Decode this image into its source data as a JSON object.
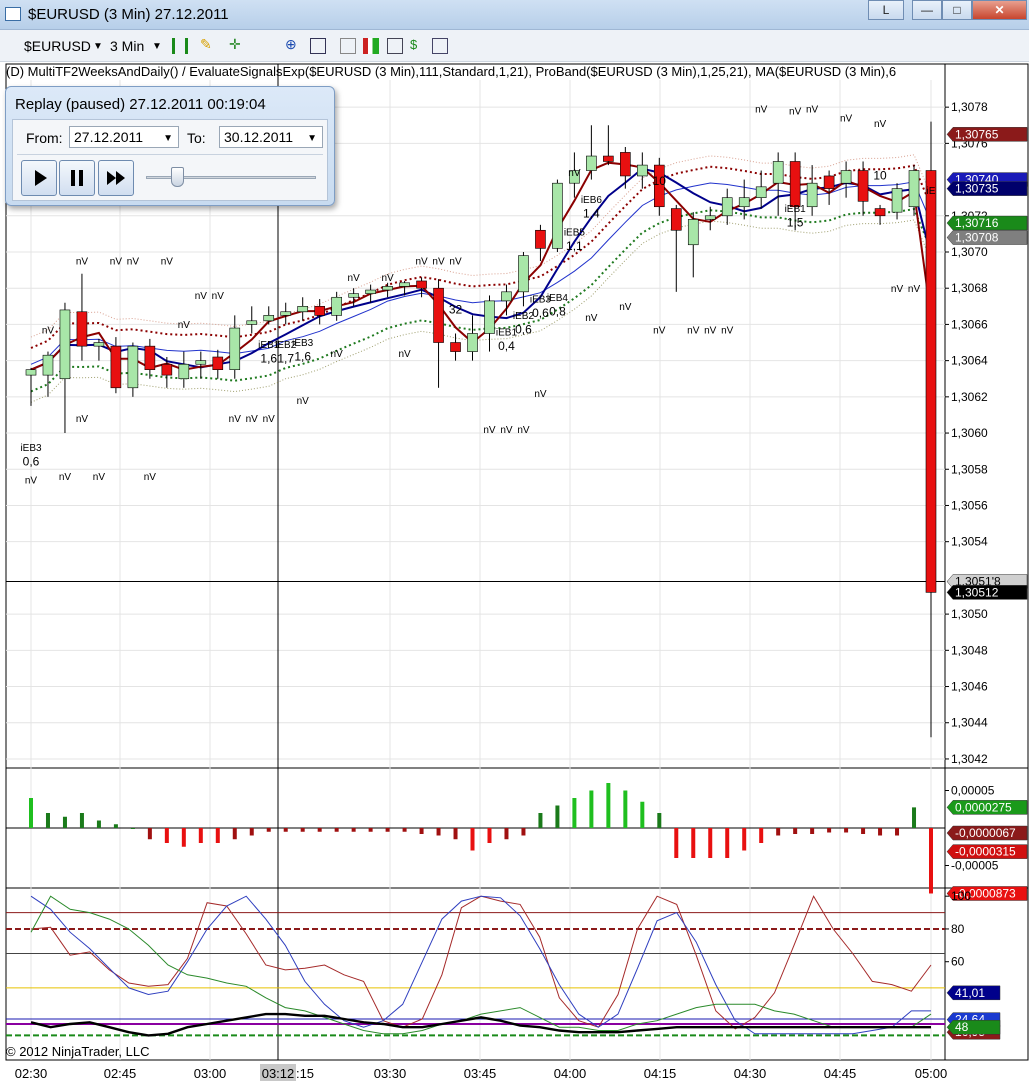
{
  "window": {
    "title": "$EURUSD (3 Min)  27.12.2011",
    "buttons": [
      "L",
      "—",
      "□",
      "✕"
    ]
  },
  "toolbar": {
    "instrument": "$EURUSD",
    "interval": "3 Min",
    "icons": [
      "bar-style-icon",
      "pencil-icon",
      "crosshair-icon",
      "zoom-icon",
      "data-box-icon",
      "properties-icon",
      "bar-chart-icon",
      "line-chart-icon",
      "dollar-icon",
      "order-icon"
    ]
  },
  "indicator_line": "(D)  MultiTF2WeeksAndDaily()  /  EvaluateSignalsExp($EURUSD  (3  Min),111,Standard,1,21),  ProBand($EURUSD  (3  Min),1,25,21),  MA($EURUSD  (3  Min),6",
  "replay": {
    "title": "Replay (paused) 27.12.2011 00:19:04",
    "from_label": "From:",
    "from_value": "27.12.2011",
    "to_label": "To:",
    "to_value": "30.12.2011",
    "slider_position": 0.18
  },
  "copyright": "© 2012 NinjaTrader, LLC",
  "colors": {
    "up_candle": "#a8e6a8",
    "down_candle": "#e81010",
    "ma_fast": "#8b0000",
    "ma_slow": "#00008b",
    "band_upper": "#8b0000",
    "band_lower": "#1f7a1f",
    "osc_up": "#1fbf1f",
    "osc_down": "#e81010"
  },
  "chart_data": {
    "type": "candlestick",
    "x_ticks": [
      "02:30",
      "02:45",
      "03:00",
      "03:12",
      "03:30",
      "03:45",
      "04:00",
      "04:15",
      "04:30",
      "04:45",
      "05:00"
    ],
    "x_tick_extra": ":15",
    "cursor_time": "03:12",
    "price_ticks": [
      "1,3078",
      "1,3076",
      "1,3072",
      "1,3070",
      "1,3068",
      "1,3066",
      "1,3064",
      "1,3062",
      "1,3060",
      "1,3058",
      "1,3056",
      "1,3054",
      "1,3050",
      "1,3048",
      "1,3046",
      "1,3044",
      "1,3042"
    ],
    "price_labels": [
      {
        "text": "1,30765",
        "value": 1.30765,
        "color": "#8b1a1a"
      },
      {
        "text": "1,30740",
        "value": 1.3074,
        "color": "#1a1ab8"
      },
      {
        "text": "1,30735",
        "value": 1.30735,
        "color": "#00006b"
      },
      {
        "text": "1,30716",
        "value": 1.30716,
        "color": "#1a8a1a"
      },
      {
        "text": "1,30708",
        "value": 1.30708,
        "color": "#7f7f7f"
      },
      {
        "text": "1,3051'8",
        "value": 1.30518,
        "color": "#d0d0d0"
      },
      {
        "text": "1,30512",
        "value": 1.30512,
        "color": "#000000"
      }
    ],
    "price_range": [
      1.30415,
      1.30795
    ],
    "candles": [
      [
        1.30632,
        1.30635,
        1.30615,
        1.30636
      ],
      [
        1.30632,
        1.30643,
        1.3062,
        1.30645
      ],
      [
        1.3063,
        1.30668,
        1.306,
        1.30672
      ],
      [
        1.30667,
        1.30648,
        1.3064,
        1.30688
      ],
      [
        1.30648,
        1.3065,
        1.3064,
        1.30652
      ],
      [
        1.30648,
        1.30625,
        1.30622,
        1.30653
      ],
      [
        1.30625,
        1.30648,
        1.3062,
        1.3065
      ],
      [
        1.30648,
        1.30635,
        1.3063,
        1.30652
      ],
      [
        1.30638,
        1.30632,
        1.30625,
        1.30642
      ],
      [
        1.3063,
        1.30638,
        1.30625,
        1.30645
      ],
      [
        1.30638,
        1.3064,
        1.3063,
        1.30645
      ],
      [
        1.30642,
        1.30635,
        1.3063,
        1.30646
      ],
      [
        1.30635,
        1.30658,
        1.3063,
        1.30665
      ],
      [
        1.3066,
        1.30662,
        1.30655,
        1.3067
      ],
      [
        1.30662,
        1.30665,
        1.3066,
        1.3067
      ],
      [
        1.30665,
        1.30667,
        1.3066,
        1.30672
      ],
      [
        1.30667,
        1.3067,
        1.30662,
        1.30675
      ],
      [
        1.3067,
        1.30665,
        1.3066,
        1.30674
      ],
      [
        1.30665,
        1.30675,
        1.30662,
        1.30678
      ],
      [
        1.30675,
        1.30677,
        1.3067,
        1.3068
      ],
      [
        1.30677,
        1.30679,
        1.30672,
        1.30682
      ],
      [
        1.30679,
        1.30681,
        1.30675,
        1.30683
      ],
      [
        1.30681,
        1.30683,
        1.30676,
        1.30684
      ],
      [
        1.30684,
        1.3068,
        1.30675,
        1.30686
      ],
      [
        1.3068,
        1.3065,
        1.30625,
        1.30685
      ],
      [
        1.3065,
        1.30645,
        1.3064,
        1.30655
      ],
      [
        1.30645,
        1.30655,
        1.3064,
        1.30665
      ],
      [
        1.30655,
        1.30673,
        1.30645,
        1.30676
      ],
      [
        1.30673,
        1.30678,
        1.30665,
        1.30682
      ],
      [
        1.30678,
        1.30698,
        1.3067,
        1.307
      ],
      [
        1.30712,
        1.30702,
        1.30695,
        1.30715
      ],
      [
        1.30702,
        1.30738,
        1.307,
        1.3074
      ],
      [
        1.30738,
        1.30745,
        1.3073,
        1.30755
      ],
      [
        1.30745,
        1.30753,
        1.3074,
        1.3077
      ],
      [
        1.30753,
        1.3075,
        1.30748,
        1.3077
      ],
      [
        1.30755,
        1.30742,
        1.30735,
        1.30758
      ],
      [
        1.30742,
        1.30748,
        1.30735,
        1.30755
      ],
      [
        1.30748,
        1.30725,
        1.3072,
        1.30752
      ],
      [
        1.30724,
        1.30712,
        1.30678,
        1.30726
      ],
      [
        1.30704,
        1.30718,
        1.30686,
        1.30722
      ],
      [
        1.30718,
        1.3072,
        1.30712,
        1.30725
      ],
      [
        1.3072,
        1.3073,
        1.30715,
        1.30735
      ],
      [
        1.30725,
        1.3073,
        1.30718,
        1.3074
      ],
      [
        1.3073,
        1.30736,
        1.30724,
        1.30745
      ],
      [
        1.30738,
        1.3075,
        1.3072,
        1.30755
      ],
      [
        1.3075,
        1.30725,
        1.30712,
        1.30755
      ],
      [
        1.30725,
        1.30738,
        1.3072,
        1.30748
      ],
      [
        1.30742,
        1.30735,
        1.30726,
        1.30745
      ],
      [
        1.30738,
        1.30745,
        1.3073,
        1.3075
      ],
      [
        1.30745,
        1.30728,
        1.3072,
        1.3075
      ],
      [
        1.30724,
        1.3072,
        1.30715,
        1.30726
      ],
      [
        1.30722,
        1.30735,
        1.30718,
        1.30738
      ],
      [
        1.30725,
        1.30745,
        1.3072,
        1.30748
      ],
      [
        1.30745,
        1.30512,
        1.30432,
        1.30772
      ]
    ],
    "signal_labels": [
      {
        "text": "iEB3",
        "bar": 0,
        "price": 1.3059
      },
      {
        "text": "0,6",
        "bar": 0,
        "price": 1.30582
      },
      {
        "text": "iEB1",
        "bar": 14,
        "price": 1.30647
      },
      {
        "text": "1,6",
        "bar": 14,
        "price": 1.30639
      },
      {
        "text": "iEB2",
        "bar": 15,
        "price": 1.30647
      },
      {
        "text": "1,7",
        "bar": 15,
        "price": 1.30639
      },
      {
        "text": "iEB3",
        "bar": 16,
        "price": 1.30648
      },
      {
        "text": "1,6",
        "bar": 16,
        "price": 1.3064
      },
      {
        "text": "32",
        "bar": 25,
        "price": 1.30666
      },
      {
        "text": "iEB1",
        "bar": 28,
        "price": 1.30654
      },
      {
        "text": "0,4",
        "bar": 28,
        "price": 1.30646
      },
      {
        "text": "iEB2",
        "bar": 29,
        "price": 1.30663
      },
      {
        "text": "0,6",
        "bar": 29,
        "price": 1.30655
      },
      {
        "text": "iEB3",
        "bar": 30,
        "price": 1.30672
      },
      {
        "text": "0,6",
        "bar": 30,
        "price": 1.30664
      },
      {
        "text": "iEB4",
        "bar": 31,
        "price": 1.30673
      },
      {
        "text": "0,8",
        "bar": 31,
        "price": 1.30665
      },
      {
        "text": "iEB5",
        "bar": 32,
        "price": 1.30709
      },
      {
        "text": "1,1",
        "bar": 32,
        "price": 1.30701
      },
      {
        "text": "iEB6",
        "bar": 33,
        "price": 1.30727
      },
      {
        "text": "1,4",
        "bar": 33,
        "price": 1.30719
      },
      {
        "text": "10",
        "bar": 37,
        "price": 1.30737
      },
      {
        "text": "iEB1",
        "bar": 45,
        "price": 1.30722
      },
      {
        "text": "1,5",
        "bar": 45,
        "price": 1.30714
      },
      {
        "text": "10",
        "bar": 50,
        "price": 1.3074
      },
      {
        "text": "iE",
        "bar": 53,
        "price": 1.30732
      }
    ],
    "nv_label": "nV",
    "nv_markers": [
      [
        0,
        1.30572
      ],
      [
        1,
        1.30655
      ],
      [
        2,
        1.30574
      ],
      [
        3,
        1.30606
      ],
      [
        3,
        1.30693
      ],
      [
        4,
        1.30574
      ],
      [
        5,
        1.30693
      ],
      [
        6,
        1.30693
      ],
      [
        7,
        1.30574
      ],
      [
        8,
        1.30693
      ],
      [
        9,
        1.30658
      ],
      [
        10,
        1.30674
      ],
      [
        11,
        1.30674
      ],
      [
        12,
        1.30606
      ],
      [
        13,
        1.30606
      ],
      [
        14,
        1.30606
      ],
      [
        16,
        1.30616
      ],
      [
        18,
        1.30642
      ],
      [
        19,
        1.30684
      ],
      [
        21,
        1.30684
      ],
      [
        22,
        1.30642
      ],
      [
        23,
        1.30693
      ],
      [
        24,
        1.30693
      ],
      [
        25,
        1.30693
      ],
      [
        27,
        1.306
      ],
      [
        28,
        1.306
      ],
      [
        29,
        1.306
      ],
      [
        30,
        1.3062
      ],
      [
        32,
        1.30742
      ],
      [
        33,
        1.30662
      ],
      [
        35,
        1.30668
      ],
      [
        37,
        1.30655
      ],
      [
        39,
        1.30655
      ],
      [
        40,
        1.30655
      ],
      [
        41,
        1.30655
      ],
      [
        43,
        1.30777
      ],
      [
        45,
        1.30776
      ],
      [
        46,
        1.30777
      ],
      [
        48,
        1.30772
      ],
      [
        50,
        1.30769
      ],
      [
        51,
        1.30678
      ],
      [
        52,
        1.30678
      ]
    ],
    "mid_osc": {
      "ticks": [
        "0,00005",
        "-0,00005"
      ],
      "range": [
        -8e-05,
        8e-05
      ],
      "values": [
        4e-05,
        2e-05,
        1.5e-05,
        2e-05,
        1e-05,
        5e-06,
        0.0,
        -1.5e-05,
        -2e-05,
        -2.5e-05,
        -2e-05,
        -2e-05,
        -1.5e-05,
        -1e-05,
        -5e-06,
        -5e-06,
        -5e-06,
        -5e-06,
        -5e-06,
        -5e-06,
        -5e-06,
        -5e-06,
        -5e-06,
        -8e-06,
        -1e-05,
        -1.5e-05,
        -3e-05,
        -2e-05,
        -1.5e-05,
        -1e-05,
        2e-05,
        3e-05,
        4e-05,
        5e-05,
        6e-05,
        5e-05,
        3.5e-05,
        2e-05,
        -4e-05,
        -4e-05,
        -4e-05,
        -4e-05,
        -3e-05,
        -2e-05,
        -1e-05,
        -8e-06,
        -8e-06,
        -6e-06,
        -6e-06,
        -8e-06,
        -1e-05,
        -1e-05,
        2.75e-05,
        -8.73e-05
      ],
      "labels": [
        {
          "text": "0,0000275",
          "value": 2.75e-05,
          "color": "#1a9a1a"
        },
        {
          "text": "-0,0000067",
          "value": -6.7e-06,
          "color": "#8b1a1a"
        },
        {
          "text": "-0,0000315",
          "value": -3.15e-05,
          "color": "#d01010"
        },
        {
          "text": "-0,0000873",
          "value": -8.73e-05,
          "color": "#e81010"
        }
      ]
    },
    "low_osc": {
      "ticks": [
        "100",
        "80",
        "60"
      ],
      "range": [
        0,
        105
      ],
      "labels": [
        {
          "text": "41,01",
          "value": 41.01,
          "color": "#00008b"
        },
        {
          "text": "24,64",
          "value": 24.64,
          "color": "#1a3ad0"
        },
        {
          "text": "16,95",
          "value": 16.95,
          "color": "#8b1a1a"
        },
        {
          "text": "48",
          "value": 20.0,
          "color": "#1a8a1a"
        }
      ],
      "levels": [
        {
          "value": 90,
          "color": "#8b1a1a",
          "dash": false
        },
        {
          "value": 80,
          "color": "#8b1a1a",
          "dash": true
        },
        {
          "value": 65,
          "color": "#444444",
          "dash": false
        },
        {
          "value": 44,
          "color": "#e6c200",
          "dash": false
        },
        {
          "value": 25,
          "color": "#1a1ab0",
          "dash": false
        },
        {
          "value": 22,
          "color": "#8a00a0",
          "dash": false
        },
        {
          "value": 15,
          "color": "#1a8a1a",
          "dash": true
        }
      ],
      "series": [
        {
          "name": "red",
          "color": "#a52a2a",
          "width": 1,
          "values": [
            80,
            81,
            64,
            66,
            55,
            47,
            45,
            46,
            62,
            96,
            94,
            77,
            58,
            55,
            56,
            58,
            52,
            48,
            24,
            20,
            25,
            52,
            93,
            100,
            97,
            95,
            75,
            38,
            24,
            20,
            40,
            80,
            100,
            95,
            64,
            30,
            19,
            26,
            41,
            70,
            100,
            80,
            65,
            48,
            46,
            42,
            58
          ]
        },
        {
          "name": "blue",
          "color": "#2f3fbf",
          "width": 1,
          "values": [
            100,
            92,
            78,
            68,
            56,
            44,
            40,
            42,
            60,
            80,
            94,
            100,
            86,
            70,
            48,
            34,
            24,
            20,
            24,
            34,
            60,
            86,
            97,
            100,
            99,
            88,
            68,
            46,
            28,
            20,
            28,
            56,
            85,
            90,
            72,
            46,
            24,
            16,
            16,
            16,
            16,
            16,
            16,
            18,
            20,
            30,
            30
          ]
        },
        {
          "name": "green",
          "color": "#2b8a2b",
          "width": 1,
          "values": [
            78,
            100,
            92,
            90,
            86,
            80,
            70,
            58,
            52,
            50,
            47,
            45,
            38,
            32,
            30,
            26,
            22,
            18,
            16,
            16,
            18,
            22,
            24,
            28,
            30,
            32,
            26,
            20,
            20,
            18,
            18,
            22,
            24,
            28,
            32,
            34,
            34,
            34,
            30,
            28,
            24,
            20,
            20,
            20,
            20,
            20,
            28
          ]
        },
        {
          "name": "black",
          "color": "#000000",
          "width": 2.4,
          "values": [
            23,
            20,
            22,
            23,
            20,
            17,
            15,
            16,
            20,
            22,
            24,
            26,
            28,
            28,
            27,
            27,
            25,
            23,
            22,
            20,
            20,
            22,
            24,
            26,
            24,
            21,
            20,
            18,
            17,
            17,
            17,
            18,
            19,
            20,
            20,
            20,
            20,
            20,
            20,
            20,
            20,
            20,
            20,
            20,
            20,
            20,
            20
          ]
        }
      ]
    }
  }
}
